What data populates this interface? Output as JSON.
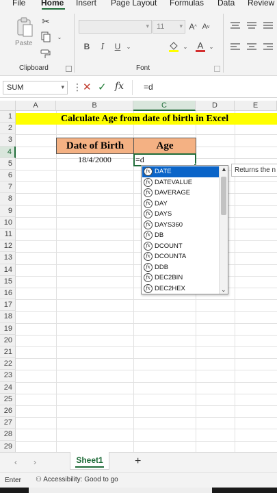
{
  "tabs": [
    "File",
    "Home",
    "Insert",
    "Page Layout",
    "Formulas",
    "Data",
    "Review"
  ],
  "ribbon": {
    "clipboard_label": "Clipboard",
    "font_label": "Font",
    "paste_label": "Paste",
    "font_size": "11",
    "font_name": "",
    "bold": "B",
    "italic": "I",
    "underline": "U"
  },
  "formula_bar": {
    "name_box": "SUM",
    "fx": "fx",
    "content": "=d"
  },
  "columns": [
    "A",
    "B",
    "C",
    "D",
    "E"
  ],
  "rows": [
    "1",
    "2",
    "3",
    "4",
    "5",
    "6",
    "7",
    "8",
    "9",
    "10",
    "11",
    "12",
    "13",
    "14",
    "15",
    "16",
    "17",
    "18",
    "19",
    "20",
    "21",
    "22",
    "23",
    "24",
    "25",
    "26",
    "27",
    "28",
    "29"
  ],
  "sheet": {
    "title": "Calculate Age from date of birth in Excel",
    "header_dob": "Date of Birth",
    "header_age": "Age",
    "dob_value": "18/4/2000",
    "active_cell_value": "=d"
  },
  "autocomplete": {
    "items": [
      "DATE",
      "DATEVALUE",
      "DAVERAGE",
      "DAY",
      "DAYS",
      "DAYS360",
      "DB",
      "DCOUNT",
      "DCOUNTA",
      "DDB",
      "DEC2BIN",
      "DEC2HEX"
    ],
    "selected": "DATE",
    "tooltip": "Returns the n"
  },
  "sheet_tabs": {
    "active": "Sheet1",
    "add": "+"
  },
  "status": {
    "mode": "Enter",
    "accessibility": "Accessibility: Good to go"
  },
  "colors": {
    "accent": "#1e6b38",
    "title_band": "#ffff00",
    "header_fill": "#f4b183",
    "ac_selected": "#0a64c8"
  }
}
